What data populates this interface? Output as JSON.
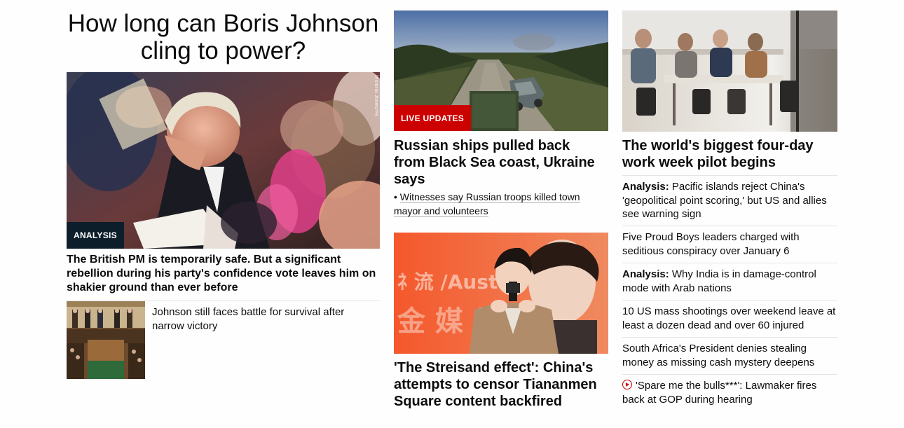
{
  "lead": {
    "headline": "How long can Boris Johnson cling to power?",
    "image_alt": "Boris Johnson rubbing his forehead at a service",
    "photo_credit": "Victoria Jones/PA",
    "badge": "ANALYSIS",
    "deck": "The British PM is temporarily safe. But a significant rebellion during his party's confidence vote leaves him on shakier ground than ever before",
    "related": {
      "image_alt": "House of Commons chamber",
      "text": "Johnson still faces battle for survival after narrow victory"
    }
  },
  "middle": {
    "story1": {
      "image_alt": "Destroyed vehicle on a road in Ukraine",
      "badge": "LIVE UPDATES",
      "title": "Russian ships pulled back from Black Sea coast, Ukraine says",
      "bullet": "Witnesses say Russian troops killed town mayor and volunteers"
    },
    "story2": {
      "image_alt": "Singer holding a microphone in front of an orange backdrop",
      "title": "'The Streisand effect': China's attempts to censor Tiananmen Square content backfired"
    }
  },
  "right": {
    "story1": {
      "image_alt": "People meeting around a table in an office",
      "title": "The world's biggest four-day work week pilot begins"
    },
    "list": [
      {
        "prefix": "Analysis:",
        "text": "Pacific islands reject China's 'geopolitical point scoring,' but US and allies see warning sign"
      },
      {
        "prefix": "",
        "text": "Five Proud Boys leaders charged with seditious conspiracy over January 6"
      },
      {
        "prefix": "Analysis:",
        "text": "Why India is in damage-control mode with Arab nations"
      },
      {
        "prefix": "",
        "text": "10 US mass shootings over weekend leave at least a dozen dead and over 60 injured"
      },
      {
        "prefix": "",
        "text": "South Africa's President denies stealing money as missing cash mystery deepens"
      },
      {
        "prefix": "",
        "text": "'Spare me the bulls***': Lawmaker fires back at GOP during hearing",
        "icon": "play-video-icon"
      }
    ]
  },
  "colors": {
    "live_red": "#cc0000",
    "analysis_navy": "#0c1e2a",
    "text": "#0c0c0c",
    "divider": "#e4e4e4"
  }
}
